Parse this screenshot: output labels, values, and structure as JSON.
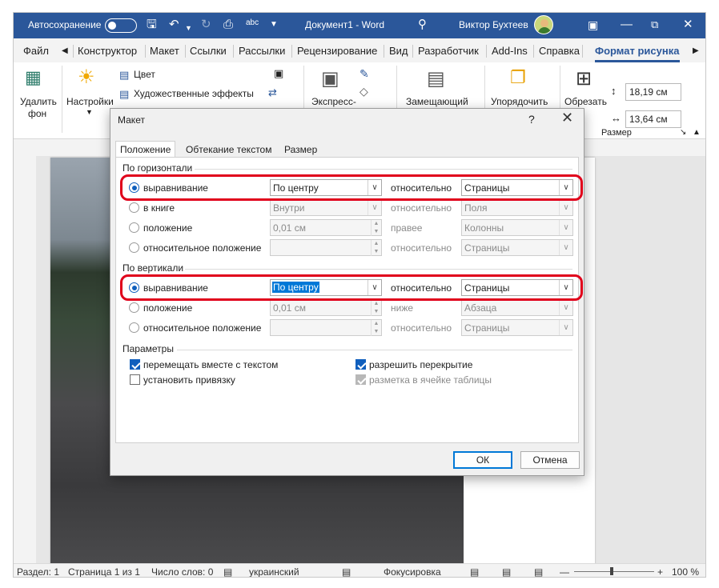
{
  "titlebar": {
    "autosave_label": "Автосохранение",
    "doc_title": "Документ1  -  Word",
    "user_name": "Виктор Бухтеев"
  },
  "tabs": [
    "Файл",
    "Конструктор",
    "Макет",
    "Ссылки",
    "Рассылки",
    "Рецензирование",
    "Вид",
    "Разработчик",
    "Add-Ins",
    "Справка",
    "Формат рисунка"
  ],
  "ribbon": {
    "remove_bg_line1": "Удалить",
    "remove_bg_line2": "фон",
    "corrections": "Настройки",
    "color": "Цвет",
    "artistic": "Художественные эффекты",
    "express": "Экспресс-",
    "alt_text": "Замещающий",
    "arrange": "Упорядочить",
    "crop": "Обрезать",
    "height": "18,19 см",
    "width": "13,64 см",
    "size_group": "Размер"
  },
  "dialog": {
    "title": "Макет",
    "help": "?",
    "tabs": [
      "Положение",
      "Обтекание текстом",
      "Размер"
    ],
    "horizontal": {
      "header": "По горизонтали",
      "rows": [
        {
          "label": "выравнивание",
          "value": "По центру",
          "rel_label": "относительно",
          "rel_value": "Страницы"
        },
        {
          "label": "в книге",
          "value": "Внутри",
          "rel_label": "относительно",
          "rel_value": "Поля"
        },
        {
          "label": "положение",
          "value": "0,01 см",
          "rel_label": "правее",
          "rel_value": "Колонны"
        },
        {
          "label": "относительное положение",
          "value": "",
          "rel_label": "относительно",
          "rel_value": "Страницы"
        }
      ]
    },
    "vertical": {
      "header": "По вертикали",
      "rows": [
        {
          "label": "выравнивание",
          "value": "По центру",
          "rel_label": "относительно",
          "rel_value": "Страницы"
        },
        {
          "label": "положение",
          "value": "0,01 см",
          "rel_label": "ниже",
          "rel_value": "Абзаца"
        },
        {
          "label": "относительное положение",
          "value": "",
          "rel_label": "относительно",
          "rel_value": "Страницы"
        }
      ]
    },
    "params": {
      "header": "Параметры",
      "move_with_text": "перемещать вместе с текстом",
      "lock_anchor": "установить привязку",
      "allow_overlap": "разрешить перекрытие",
      "layout_in_cell": "разметка в ячейке таблицы"
    },
    "ok": "ОК",
    "cancel": "Отмена"
  },
  "status": {
    "section": "Раздел: 1",
    "page": "Страница 1 из 1",
    "words": "Число слов: 0",
    "language": "украинский",
    "focus": "Фокусировка",
    "zoom": "100 %"
  },
  "colors": {
    "word_blue": "#2b579a",
    "highlight_red": "#e0001b",
    "accent": "#0f5fbd"
  }
}
